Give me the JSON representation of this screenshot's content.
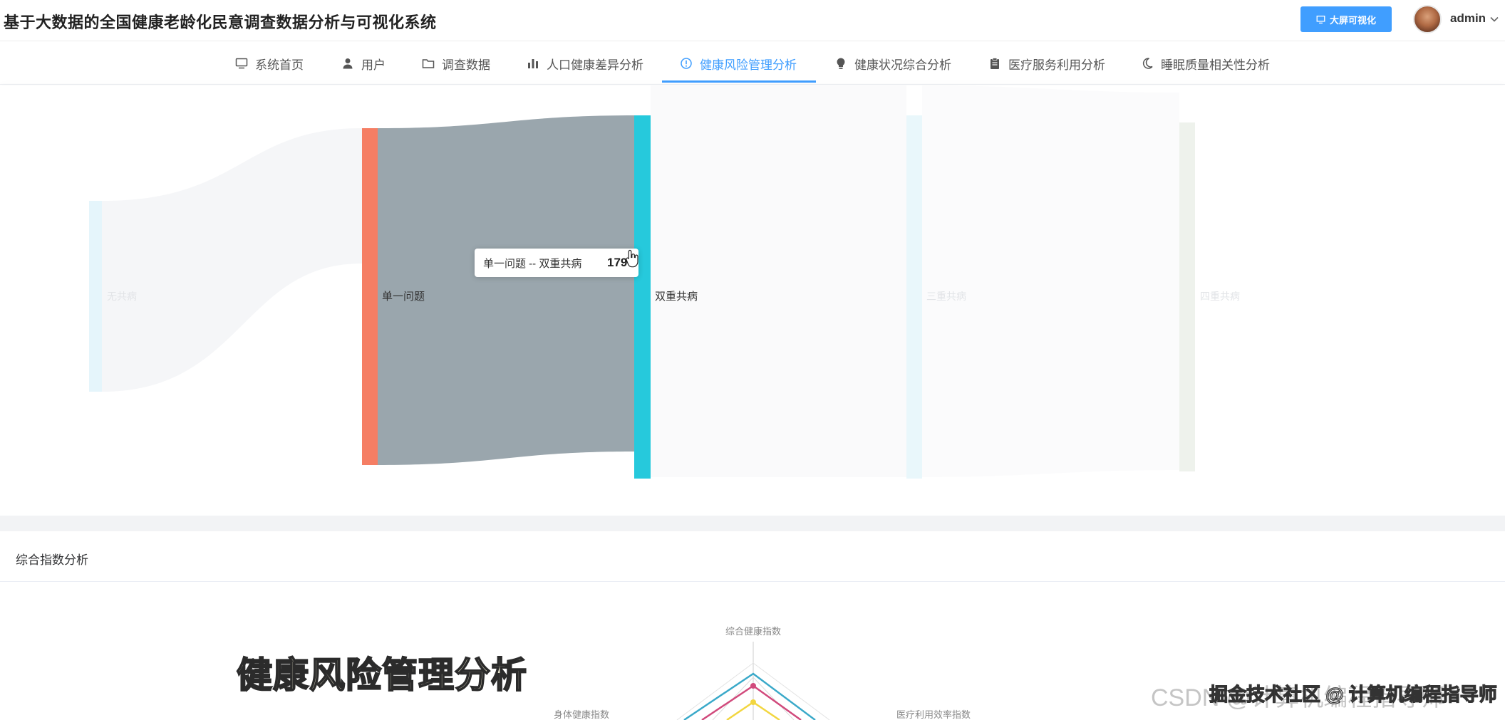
{
  "header": {
    "title": "基于大数据的全国健康老龄化民意调查数据分析与可视化系统",
    "bigscreen_button": "大屏可视化",
    "username": "admin"
  },
  "nav": {
    "items": [
      {
        "label": "系统首页",
        "icon": "monitor-icon"
      },
      {
        "label": "用户",
        "icon": "user-icon"
      },
      {
        "label": "调查数据",
        "icon": "folder-icon"
      },
      {
        "label": "人口健康差异分析",
        "icon": "bar-chart-icon"
      },
      {
        "label": "健康风险管理分析",
        "icon": "info-circle-icon",
        "active": true
      },
      {
        "label": "健康状况综合分析",
        "icon": "bulb-icon"
      },
      {
        "label": "医疗服务利用分析",
        "icon": "clipboard-icon"
      },
      {
        "label": "睡眠质量相关性分析",
        "icon": "moon-icon"
      }
    ],
    "active_color": "#409eff"
  },
  "sankey": {
    "nodes": [
      {
        "name": "无共病",
        "color": "#e5f5fb"
      },
      {
        "name": "单一问题",
        "color": "#f57e64"
      },
      {
        "name": "双重共病",
        "color": "#26c9dc"
      },
      {
        "name": "三重共病",
        "color": "#e9f7fb"
      },
      {
        "name": "四重共病",
        "color": "#eef2ec"
      }
    ],
    "highlighted_link": {
      "source": "单一问题",
      "target": "双重共病",
      "color": "#9aa6ad"
    },
    "tooltip": {
      "text": "单一问题 -- 双重共病",
      "value": "179"
    }
  },
  "radar": {
    "section_title": "综合指数分析",
    "indicators": [
      "综合健康指数",
      "医疗利用效率指数",
      "身体健康指数"
    ],
    "series_colors": [
      "#3aa9c9",
      "#d14a7c",
      "#f2d640"
    ]
  },
  "overlay": {
    "caption": "健康风险管理分析",
    "watermark": "CSDN @计算机编程指导师",
    "community": "掘金技术社区 @ 计算机编程指导师"
  }
}
